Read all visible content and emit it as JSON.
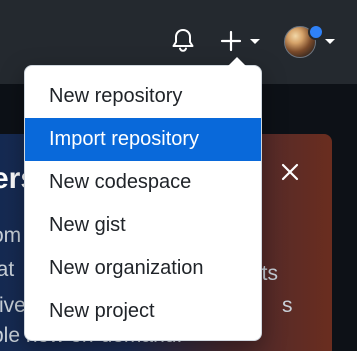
{
  "header": {
    "icons": [
      "bell-icon",
      "plus-icon",
      "chevron-down-icon",
      "avatar"
    ],
    "colors": {
      "background": "#24292f",
      "icon": "#ffffff",
      "notification_dot": "#2f81f7"
    }
  },
  "create_menu": {
    "items": [
      {
        "label": "New repository",
        "active": false
      },
      {
        "label": "Import repository",
        "active": true
      },
      {
        "label": "New codespace",
        "active": false
      },
      {
        "label": "New gist",
        "active": false
      },
      {
        "label": "New organization",
        "active": false
      },
      {
        "label": "New project",
        "active": false
      }
    ],
    "colors": {
      "active_background": "#0969da",
      "active_text": "#ffffff",
      "text": "#1f2328"
    }
  },
  "background_banner": {
    "title_fragment": "ers",
    "line_fragments": [
      "om",
      "lat",
      "rive",
      "ble now on-demand."
    ],
    "right_fragments": [
      "nts",
      "s"
    ],
    "close_icon": "close-icon"
  }
}
